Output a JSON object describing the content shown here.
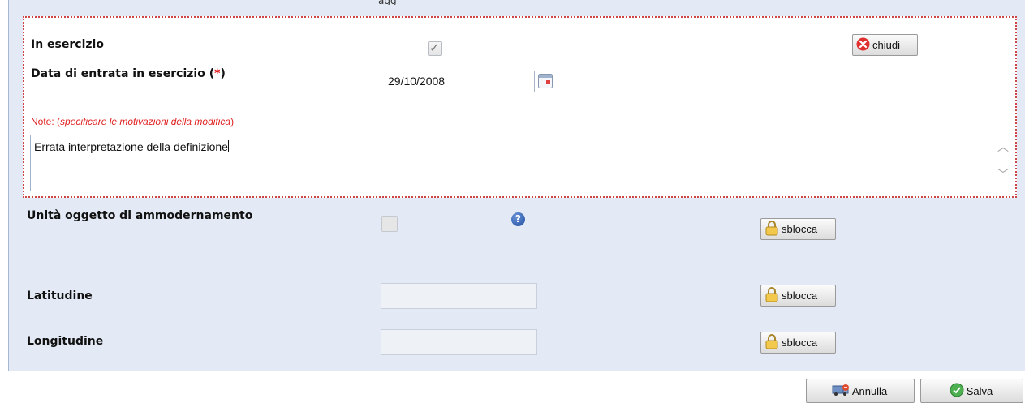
{
  "fragment_text": "agg",
  "in_esercizio": {
    "label": "In esercizio",
    "checked_glyph": "✓",
    "close_label": "chiudi"
  },
  "data_entrata": {
    "label": "Data di entrata in esercizio (",
    "required_mark": "*",
    "label_end": ")",
    "value": "29/10/2008",
    "calendar_icon": "calendar-icon"
  },
  "note": {
    "prefix": "Note: (",
    "hint": "specificare le motivazioni della modifica",
    "suffix": ")",
    "value": "Errata interpretazione della definizione"
  },
  "ammodernamento": {
    "label": "Unità oggetto di ammodernamento",
    "help_glyph": "?",
    "unlock_label": "sblocca"
  },
  "latitudine": {
    "label": "Latitudine",
    "value": "",
    "unlock_label": "sblocca"
  },
  "longitudine": {
    "label": "Longitudine",
    "value": "",
    "unlock_label": "sblocca"
  },
  "footer": {
    "cancel_label": "Annulla",
    "save_label": "Salva"
  },
  "colors": {
    "required": "#e01010",
    "panel": "#e3eaf6",
    "highlight_border": "#cc4444"
  }
}
